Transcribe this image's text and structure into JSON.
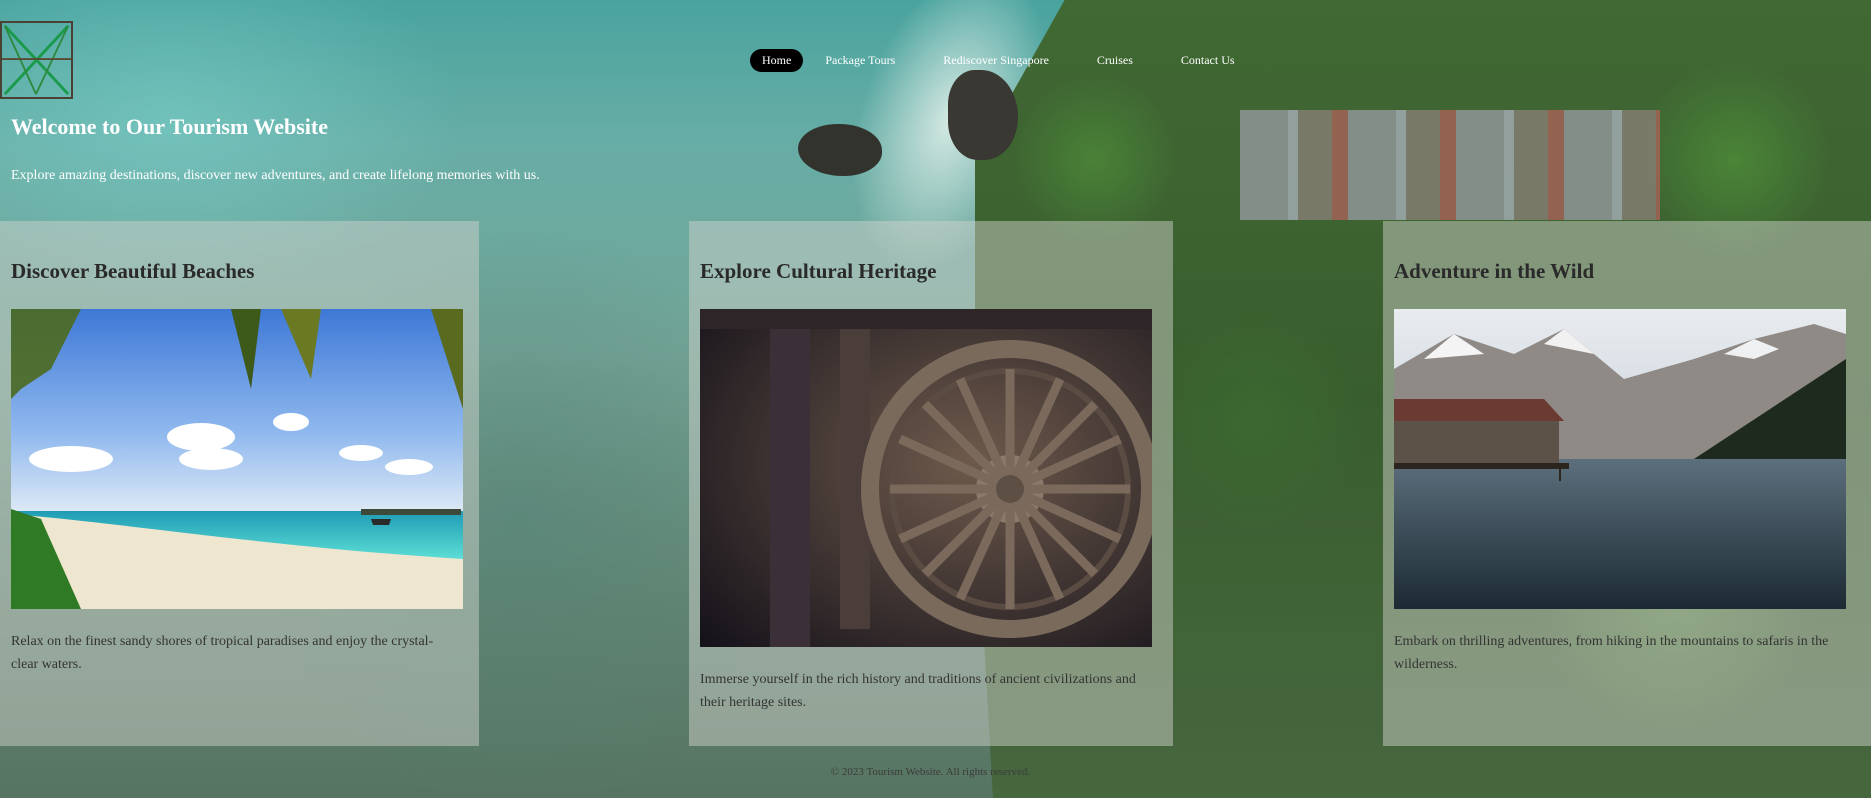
{
  "nav": {
    "items": [
      {
        "label": "Home"
      },
      {
        "label": "Package Tours"
      },
      {
        "label": "Rediscover Singapore"
      },
      {
        "label": "Cruises"
      },
      {
        "label": "Contact Us"
      }
    ]
  },
  "hero": {
    "title": "Welcome to Our Tourism Website",
    "subtitle": "Explore amazing destinations, discover new adventures, and create lifelong memories with us."
  },
  "cards": [
    {
      "title": "Discover Beautiful Beaches",
      "text": "Relax on the finest sandy shores of tropical paradises and enjoy the crystal-clear waters."
    },
    {
      "title": "Explore Cultural Heritage",
      "text": "Immerse yourself in the rich history and traditions of ancient civilizations and their heritage sites."
    },
    {
      "title": "Adventure in the Wild",
      "text": "Embark on thrilling adventures, from hiking in the mountains to safaris in the wilderness."
    }
  ],
  "footer": {
    "text": "© 2023 Tourism Website. All rights reserved."
  },
  "colors": {
    "nav_active_bg": "#000000",
    "hero_text": "#ffffff",
    "card_overlay": "#d0d4cc"
  }
}
